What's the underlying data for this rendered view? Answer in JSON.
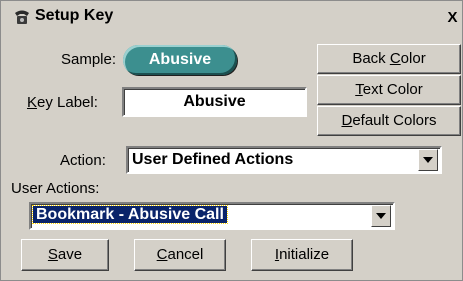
{
  "window": {
    "title": "Setup Key",
    "icon": "phone-icon",
    "close_label": "X"
  },
  "sample": {
    "label": "Sample:",
    "pill_text": "Abusive",
    "pill_color": "#3c8f8f"
  },
  "key_label": {
    "label": "Key Label:",
    "value": "Abusive"
  },
  "buttons": {
    "back_color": "Back Color",
    "text_color": "Text Color",
    "default_colors": "Default Colors",
    "save": "Save",
    "cancel": "Cancel",
    "initialize": "Initialize"
  },
  "action": {
    "label": "Action:",
    "selected": "User Defined Actions"
  },
  "user_actions": {
    "label": "User Actions:",
    "selected": "Bookmark - Abusive Call"
  },
  "colors": {
    "dialog_bg": "#d4d0c8",
    "selection_bg": "#0a246a"
  }
}
